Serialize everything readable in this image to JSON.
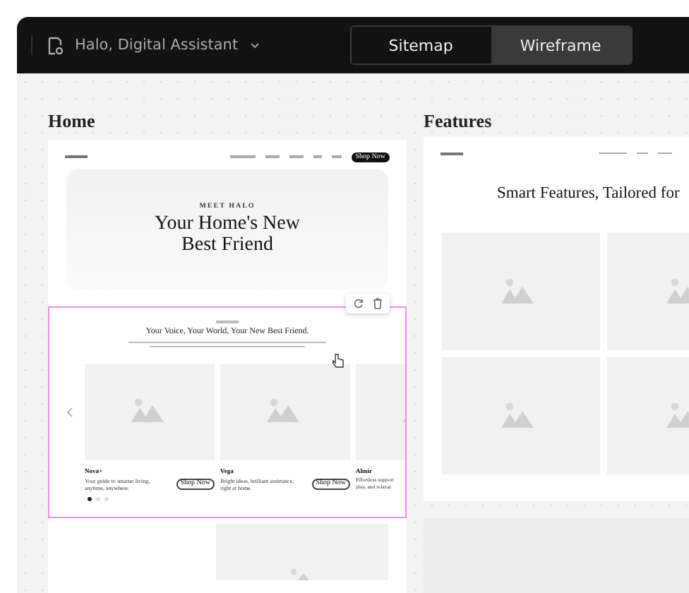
{
  "topbar": {
    "project_title": "Halo, Digital Assistant",
    "tabs": [
      {
        "label": "Sitemap",
        "selected": false
      },
      {
        "label": "Wireframe",
        "selected": true
      }
    ]
  },
  "pages": [
    {
      "kind": "home",
      "title": "Home",
      "hero": {
        "eyebrow": "MEET HALO",
        "heading": "Your Home's New Best Friend",
        "cta": "Shop Now"
      },
      "section": {
        "selected": true,
        "heading": "Your Voice, Your World, Your New Best Friend.",
        "products": [
          {
            "name": "Nova+",
            "description": "Your guide to smarter living, anytime, anywhere.",
            "button": "Shop Now"
          },
          {
            "name": "Vega",
            "description": "Bright ideas, brilliant assistance, right at home.",
            "button": "Shop Now"
          },
          {
            "name": "Almir",
            "description": "Effortless support\nplay, and relaxat"
          }
        ]
      }
    },
    {
      "kind": "features",
      "title": "Features",
      "heading": "Smart Features, Tailored for"
    }
  ]
}
